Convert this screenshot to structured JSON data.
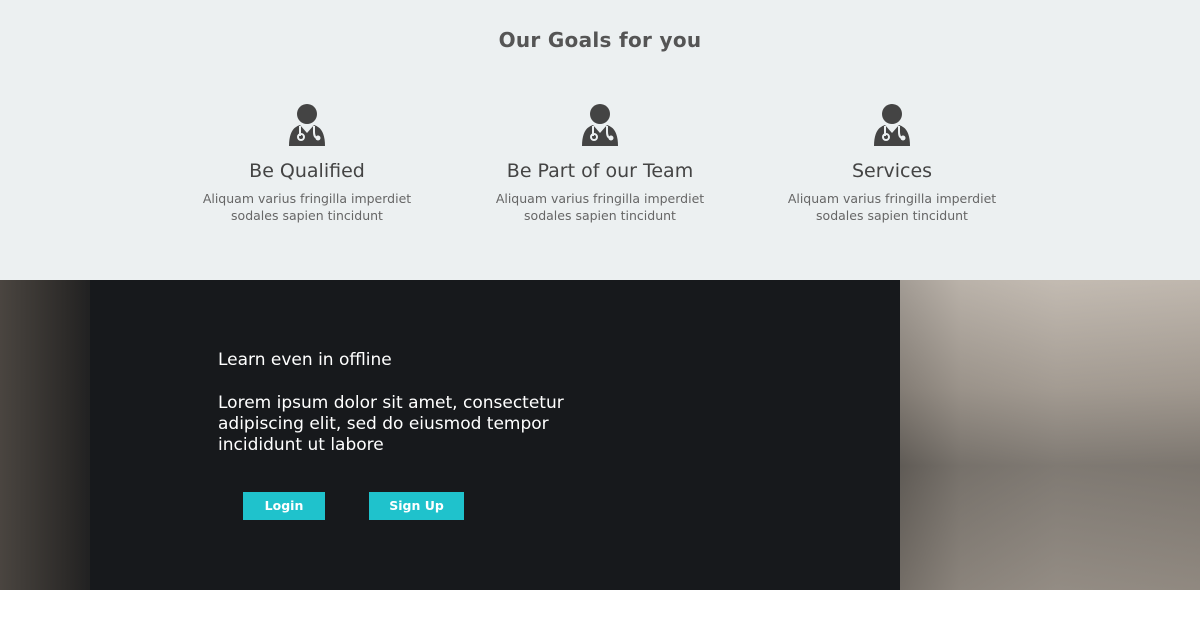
{
  "goals": {
    "title": "Our Goals for you",
    "items": [
      {
        "icon": "doctor-icon",
        "heading": "Be Qualified",
        "line1": "Aliquam varius fringilla imperdiet",
        "line2": "sodales sapien tincidunt"
      },
      {
        "icon": "doctor-icon",
        "heading": "Be Part of our Team",
        "line1": "Aliquam varius fringilla imperdiet",
        "line2": "sodales sapien tincidunt"
      },
      {
        "icon": "doctor-icon",
        "heading": "Services",
        "line1": "Aliquam varius fringilla imperdiet",
        "line2": "sodales sapien tincidunt"
      }
    ]
  },
  "hero": {
    "title": "Learn even in offline",
    "text": "Lorem ipsum dolor sit amet, consectetur adipiscing elit, sed do eiusmod tempor incididunt ut labore",
    "login_label": "Login",
    "signup_label": "Sign Up"
  },
  "colors": {
    "accent": "#1fc2cc",
    "goals_background": "#ecf0f1",
    "icon": "#444444"
  }
}
